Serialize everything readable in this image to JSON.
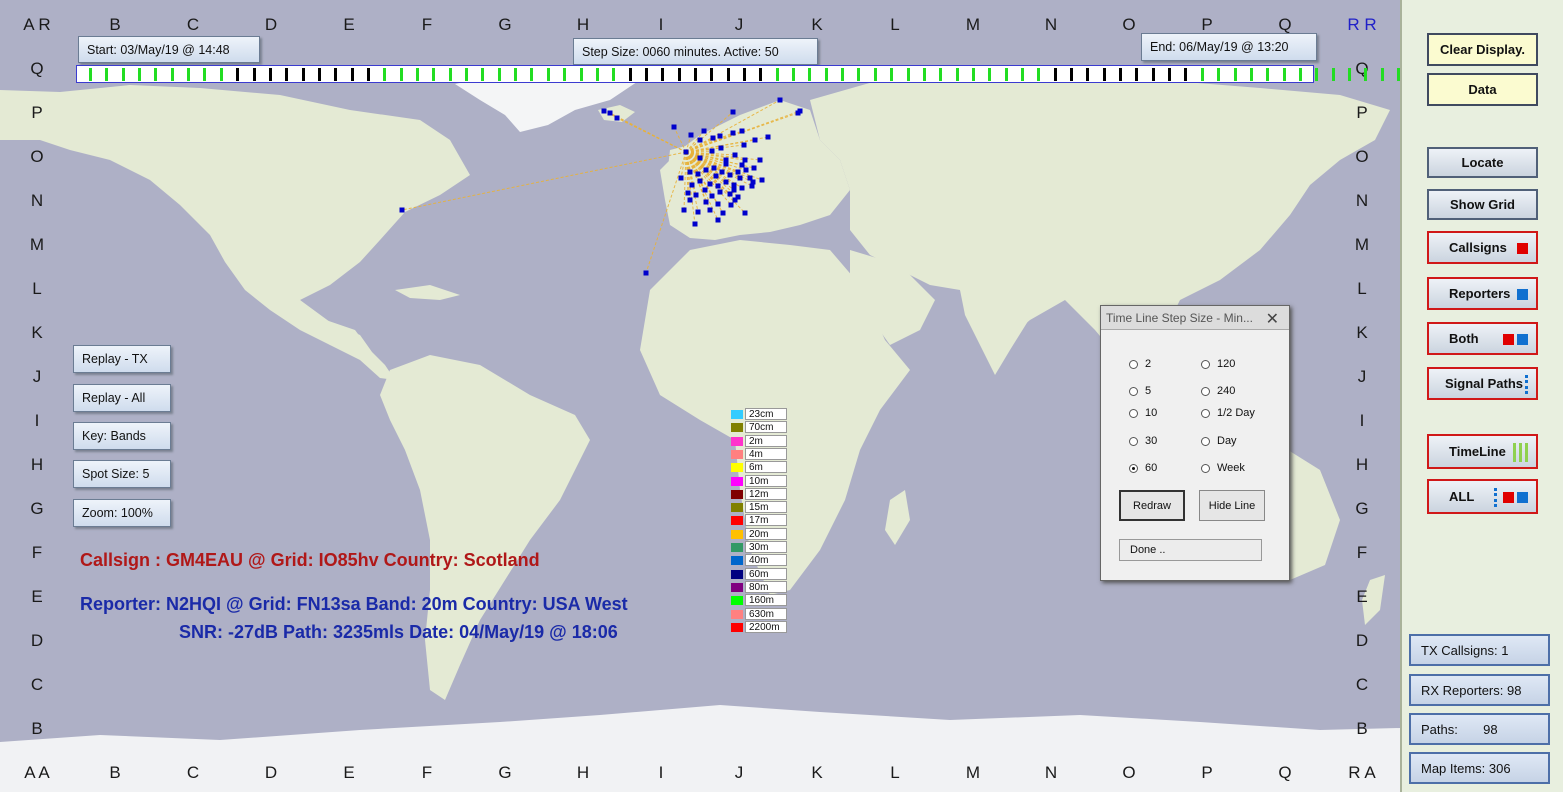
{
  "grid": {
    "top_labels": [
      "A R",
      "B",
      "C",
      "D",
      "E",
      "F",
      "G",
      "H",
      "I",
      "J",
      "K",
      "L",
      "M",
      "N",
      "O",
      "P",
      "Q",
      "R R"
    ],
    "bottom_labels": [
      "A A",
      "B",
      "C",
      "D",
      "E",
      "F",
      "G",
      "H",
      "I",
      "J",
      "K",
      "L",
      "M",
      "N",
      "O",
      "P",
      "Q",
      "R A"
    ],
    "left_labels": [
      "Q",
      "P",
      "O",
      "N",
      "M",
      "L",
      "K",
      "J",
      "I",
      "H",
      "G",
      "F",
      "E",
      "D",
      "C",
      "B"
    ],
    "right_labels": [
      "Q",
      "P",
      "O",
      "N",
      "M",
      "L",
      "K",
      "J",
      "I",
      "H",
      "G",
      "F",
      "E",
      "D",
      "C",
      "B"
    ]
  },
  "timeline": {
    "start_label": "Start: 03/May/19 @ 14:48",
    "step_label": "Step Size: 0060 minutes. Active: 50",
    "end_label": "End:  06/May/19 @ 13:20"
  },
  "left_buttons": {
    "replay_tx": "Replay - TX",
    "replay_all": "Replay - All",
    "key": "Key:  Bands",
    "spot_size": "Spot Size:   5",
    "zoom": "Zoom: 100%"
  },
  "info": {
    "callsign_line": "Callsign  : GM4EAU @ Grid: IO85hv  Country: Scotland",
    "reporter_line": "Reporter: N2HQI @ Grid: FN13sa  Band:  20m  Country: USA West",
    "snr_line": "SNR: -27dB  Path: 3235mls  Date: 04/May/19 @ 18:06"
  },
  "legend": [
    {
      "label": "23cm",
      "color": "#33ccff"
    },
    {
      "label": "70cm",
      "color": "#808000"
    },
    {
      "label": "2m",
      "color": "#ff33cc"
    },
    {
      "label": "4m",
      "color": "#ff8080"
    },
    {
      "label": "6m",
      "color": "#ffff00"
    },
    {
      "label": "10m",
      "color": "#ff00ff"
    },
    {
      "label": "12m",
      "color": "#800000"
    },
    {
      "label": "15m",
      "color": "#808000"
    },
    {
      "label": "17m",
      "color": "#ff0000"
    },
    {
      "label": "20m",
      "color": "#ffc000"
    },
    {
      "label": "30m",
      "color": "#339966"
    },
    {
      "label": "40m",
      "color": "#0066cc"
    },
    {
      "label": "60m",
      "color": "#000080"
    },
    {
      "label": "80m",
      "color": "#800080"
    },
    {
      "label": "160m",
      "color": "#00ff00"
    },
    {
      "label": "630m",
      "color": "#ff8080"
    },
    {
      "label": "2200m",
      "color": "#ff0000"
    }
  ],
  "dialog": {
    "title": "Time Line Step Size - Min...",
    "close": "✕",
    "options": [
      "2",
      "120",
      "5",
      "240",
      "10",
      "1/2 Day",
      "30",
      "Day",
      "60",
      "Week"
    ],
    "selected": "60",
    "redraw": "Redraw",
    "hide_line": "Hide Line",
    "status": "Done .."
  },
  "panel": {
    "clear": "Clear Display.",
    "data": "Data",
    "locate": "Locate",
    "show_grid": "Show Grid",
    "callsigns": "Callsigns",
    "reporters": "Reporters",
    "both": "Both",
    "signal_paths": "Signal Paths",
    "timeline": "TimeLine",
    "all": "ALL"
  },
  "stats": {
    "tx_callsigns": "TX Callsigns: 1",
    "rx_reporters": "RX Reporters: 98",
    "paths": "Paths:       98",
    "map_items": "Map Items: 306"
  },
  "colors": {
    "callsign_text": "#b01818",
    "reporter_text": "#1a2aa8",
    "spot_blue": "#0000cc",
    "path_line": "#e8b23a",
    "tick_green": "#22dd22",
    "tick_black": "#000000",
    "ocean": "#aeb0c6",
    "land": "#e6ebd6"
  },
  "timeline_ticks": "GGGGGGGGGBBBBBBBBBGGGGGGGGGGGGGGGBBBBBBBBBGGGGGGGGGGGGGGGGGBBBBBBBBBGGGGGGGGGGGGGW"
}
